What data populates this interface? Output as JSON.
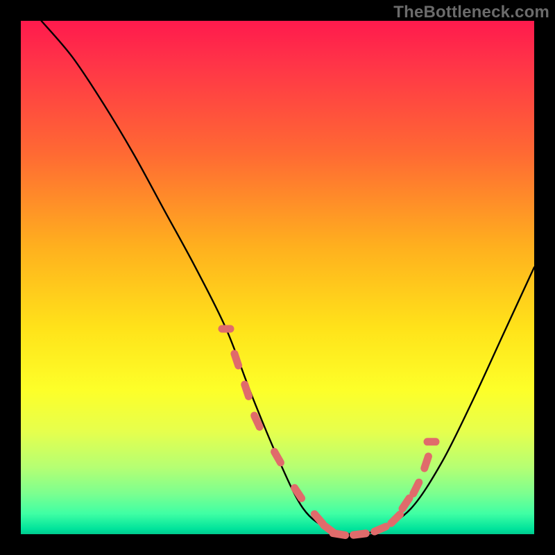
{
  "watermark": "TheBottleneck.com",
  "chart_data": {
    "type": "line",
    "title": "",
    "xlabel": "",
    "ylabel": "",
    "xlim": [
      0,
      100
    ],
    "ylim": [
      0,
      100
    ],
    "grid": false,
    "legend": false,
    "series": [
      {
        "name": "bottleneck-curve",
        "x": [
          4,
          10,
          16,
          22,
          28,
          34,
          40,
          45,
          50,
          55,
          60,
          65,
          70,
          76,
          82,
          88,
          94,
          100
        ],
        "y": [
          100,
          93,
          84,
          74,
          63,
          52,
          40,
          27,
          15,
          5,
          1,
          0,
          1,
          5,
          14,
          26,
          39,
          52
        ]
      }
    ],
    "valley_markers": {
      "name": "valley-dots",
      "x": [
        40,
        42,
        44,
        46,
        50,
        54,
        58,
        60,
        62,
        66,
        70,
        73,
        75,
        77,
        79,
        80
      ],
      "y": [
        40,
        34,
        28,
        22,
        15,
        8,
        3,
        1,
        0,
        0,
        1,
        3,
        6,
        9,
        14,
        18
      ]
    },
    "background_gradient": {
      "top": "#ff1a4d",
      "upper_mid": "#ffb01e",
      "lower_mid": "#fdff29",
      "bottom": "#00c98e"
    }
  }
}
